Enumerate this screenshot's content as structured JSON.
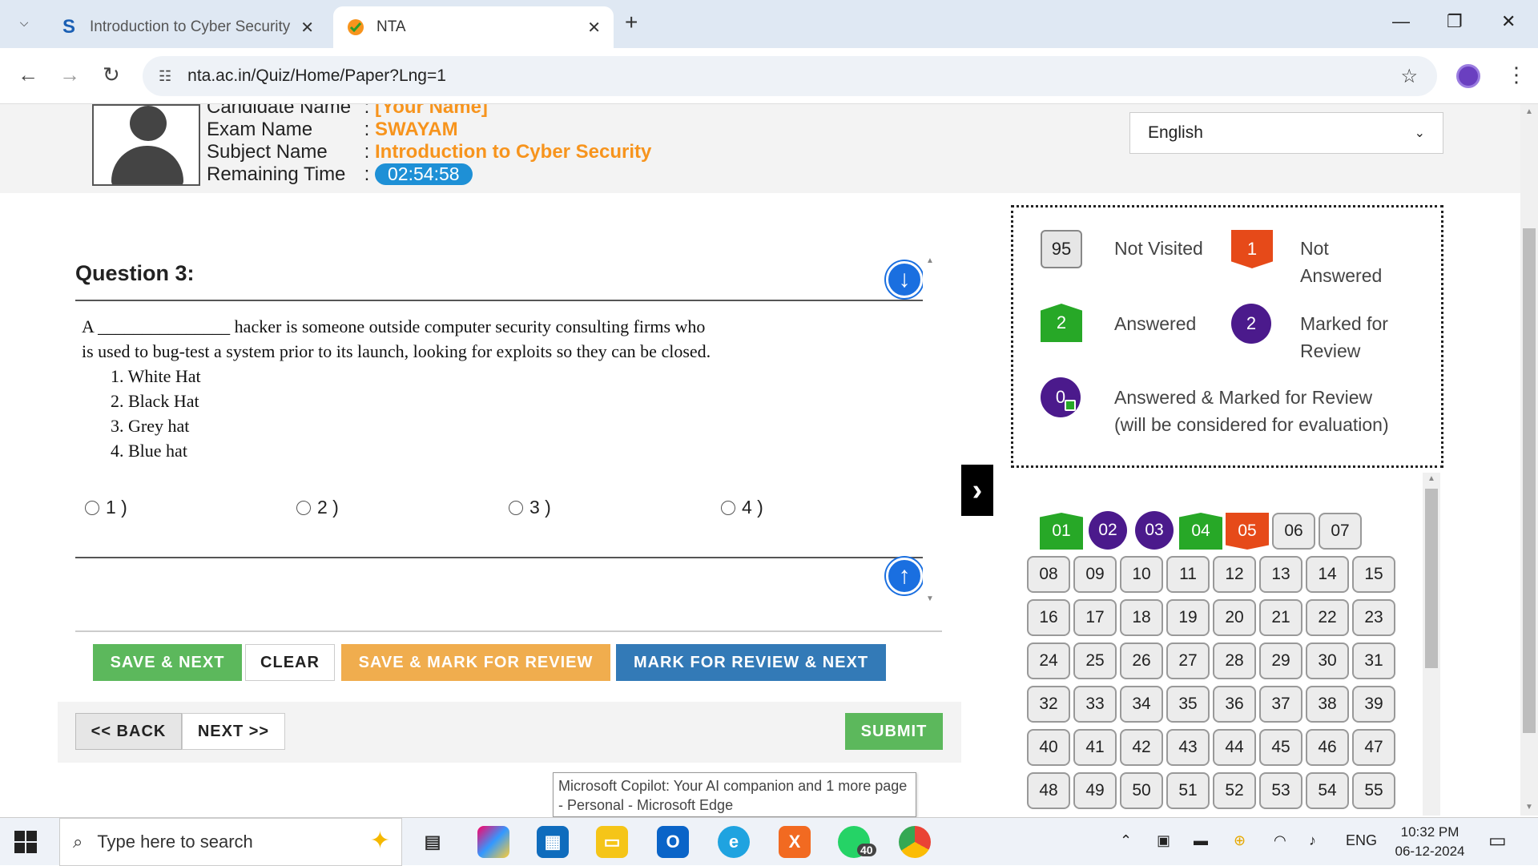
{
  "browser": {
    "tabs": [
      {
        "title": "Introduction to Cyber Security",
        "favicon": "S",
        "active": false
      },
      {
        "title": "NTA",
        "favicon": "nta-logo",
        "active": true
      }
    ],
    "url": "nta.ac.in/Quiz/Home/Paper?Lng=1"
  },
  "candidate": {
    "name_label": "Candidate Name",
    "name_value": "[Your Name]",
    "exam_label": "Exam Name",
    "exam_value": "SWAYAM",
    "subject_label": "Subject Name",
    "subject_value": "Introduction to Cyber Security",
    "time_label": "Remaining Time",
    "time_value": "02:54:58",
    "separator": ":"
  },
  "language": {
    "selected": "English"
  },
  "question": {
    "title": "Question 3:",
    "text_line1": "A _______________ hacker is someone outside computer security consulting firms who",
    "text_line2": "is used to bug-test a system prior to its launch, looking for exploits so they can be closed.",
    "options": [
      "1.   White Hat",
      "2.   Black Hat",
      "3.   Grey hat",
      "4.   Blue hat"
    ],
    "radio_labels": [
      "1 )",
      "2 )",
      "3 )",
      "4 )"
    ]
  },
  "buttons": {
    "save_next": "SAVE & NEXT",
    "clear": "CLEAR",
    "save_mark": "SAVE & MARK FOR REVIEW",
    "mark_next": "MARK FOR REVIEW & NEXT",
    "back": "<< BACK",
    "next": "NEXT >>",
    "submit": "SUBMIT"
  },
  "legend": {
    "not_visited": {
      "count": "95",
      "label": "Not Visited"
    },
    "not_answered": {
      "count": "1",
      "label_l1": "Not",
      "label_l2": "Answered"
    },
    "answered": {
      "count": "2",
      "label": "Answered"
    },
    "marked": {
      "count": "2",
      "label_l1": "Marked for",
      "label_l2": "Review"
    },
    "answered_marked": {
      "count": "0",
      "label_l1": "Answered & Marked for Review",
      "label_l2": "(will be considered for evaluation)"
    }
  },
  "palette": [
    {
      "n": "01",
      "s": "answered"
    },
    {
      "n": "02",
      "s": "marked"
    },
    {
      "n": "03",
      "s": "marked"
    },
    {
      "n": "04",
      "s": "answered"
    },
    {
      "n": "05",
      "s": "not-answered"
    },
    {
      "n": "06",
      "s": "not-visited"
    },
    {
      "n": "07",
      "s": "not-visited"
    },
    {
      "n": "08",
      "s": "not-visited"
    },
    {
      "n": "09",
      "s": "not-visited"
    },
    {
      "n": "10",
      "s": "not-visited"
    },
    {
      "n": "11",
      "s": "not-visited"
    },
    {
      "n": "12",
      "s": "not-visited"
    },
    {
      "n": "13",
      "s": "not-visited"
    },
    {
      "n": "14",
      "s": "not-visited"
    },
    {
      "n": "15",
      "s": "not-visited"
    },
    {
      "n": "16",
      "s": "not-visited"
    },
    {
      "n": "17",
      "s": "not-visited"
    },
    {
      "n": "18",
      "s": "not-visited"
    },
    {
      "n": "19",
      "s": "not-visited"
    },
    {
      "n": "20",
      "s": "not-visited"
    },
    {
      "n": "21",
      "s": "not-visited"
    },
    {
      "n": "22",
      "s": "not-visited"
    },
    {
      "n": "23",
      "s": "not-visited"
    },
    {
      "n": "24",
      "s": "not-visited"
    },
    {
      "n": "25",
      "s": "not-visited"
    },
    {
      "n": "26",
      "s": "not-visited"
    },
    {
      "n": "27",
      "s": "not-visited"
    },
    {
      "n": "28",
      "s": "not-visited"
    },
    {
      "n": "29",
      "s": "not-visited"
    },
    {
      "n": "30",
      "s": "not-visited"
    },
    {
      "n": "31",
      "s": "not-visited"
    },
    {
      "n": "32",
      "s": "not-visited"
    },
    {
      "n": "33",
      "s": "not-visited"
    },
    {
      "n": "34",
      "s": "not-visited"
    },
    {
      "n": "35",
      "s": "not-visited"
    },
    {
      "n": "36",
      "s": "not-visited"
    },
    {
      "n": "37",
      "s": "not-visited"
    },
    {
      "n": "38",
      "s": "not-visited"
    },
    {
      "n": "39",
      "s": "not-visited"
    },
    {
      "n": "40",
      "s": "not-visited"
    },
    {
      "n": "41",
      "s": "not-visited"
    },
    {
      "n": "42",
      "s": "not-visited"
    },
    {
      "n": "43",
      "s": "not-visited"
    },
    {
      "n": "44",
      "s": "not-visited"
    },
    {
      "n": "45",
      "s": "not-visited"
    },
    {
      "n": "46",
      "s": "not-visited"
    },
    {
      "n": "47",
      "s": "not-visited"
    },
    {
      "n": "48",
      "s": "not-visited"
    },
    {
      "n": "49",
      "s": "not-visited"
    },
    {
      "n": "50",
      "s": "not-visited"
    },
    {
      "n": "51",
      "s": "not-visited"
    },
    {
      "n": "52",
      "s": "not-visited"
    },
    {
      "n": "53",
      "s": "not-visited"
    },
    {
      "n": "54",
      "s": "not-visited"
    },
    {
      "n": "55",
      "s": "not-visited"
    }
  ],
  "tooltip": {
    "line1": "Microsoft Copilot: Your AI companion and 1 more page",
    "line2": "- Personal - Microsoft Edge"
  },
  "taskbar": {
    "search_placeholder": "Type here to search",
    "whatsapp_badge": "40",
    "language": "ENG",
    "time": "10:32 PM",
    "date": "06-12-2024"
  },
  "colors": {
    "answered": "#27a827",
    "not_answered": "#e64a19",
    "marked": "#4b1a8c",
    "accent_orange": "#f7941d",
    "timer_blue": "#1e90d6"
  }
}
